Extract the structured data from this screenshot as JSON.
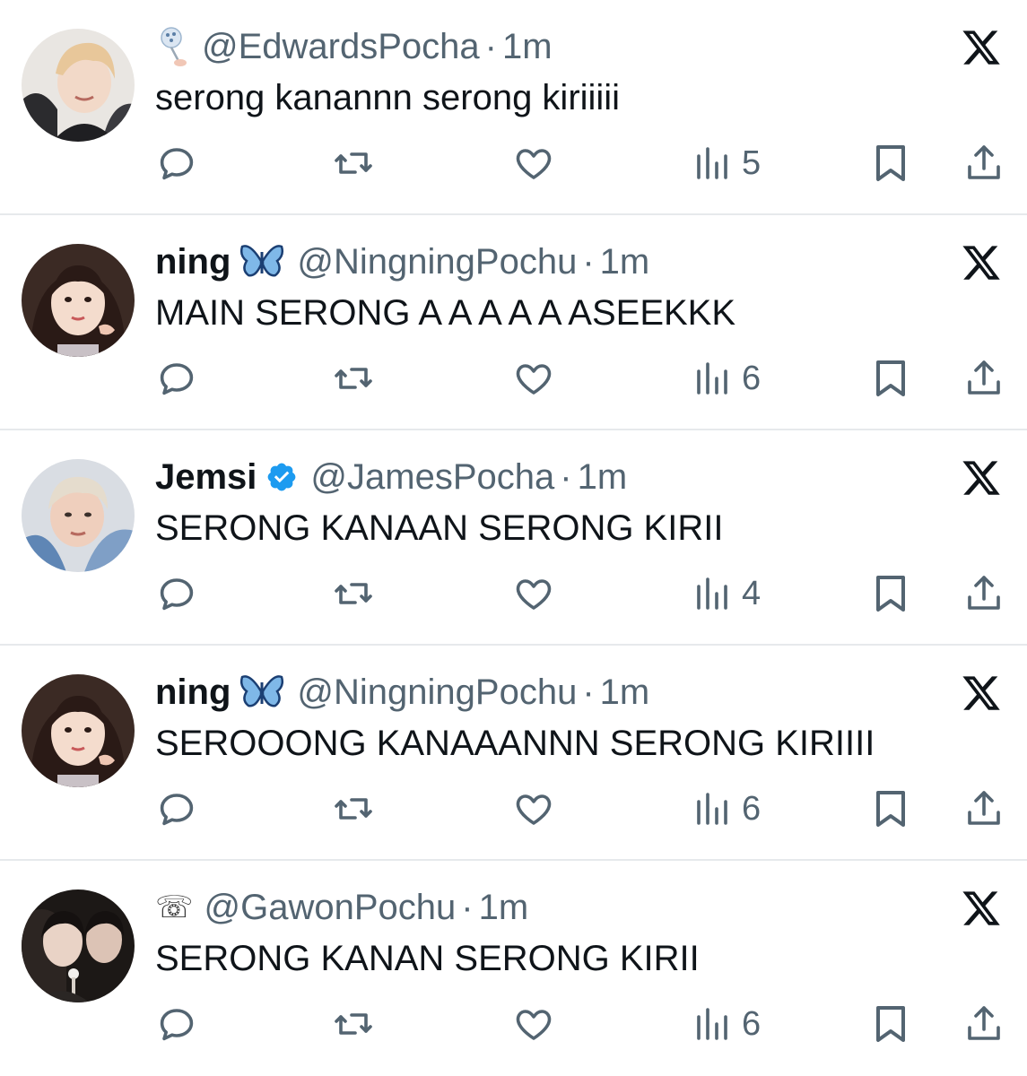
{
  "colors": {
    "text_primary": "#0f1419",
    "text_secondary": "#536471",
    "divider": "#e6e9ec",
    "verified_blue": "#1d9bf0"
  },
  "separator": "·",
  "tweets": [
    {
      "display_name": "",
      "name_emoji": "",
      "prefix_emoji": "blue-rattle-toy-icon",
      "verified": false,
      "handle": "@EdwardsPocha",
      "time": "1m",
      "text": "serong kanannn serong kiriiiii",
      "views": "5"
    },
    {
      "display_name": "ning",
      "name_emoji": "butterfly-icon",
      "prefix_emoji": "",
      "verified": false,
      "handle": "@NingningPochu",
      "time": "1m",
      "text": "MAIN SERONG A A A A A ASEEKKK",
      "views": "6"
    },
    {
      "display_name": "Jemsi",
      "name_emoji": "",
      "prefix_emoji": "",
      "verified": true,
      "handle": "@JamesPocha",
      "time": "1m",
      "text": "SERONG KANAAN SERONG KIRII",
      "views": "4"
    },
    {
      "display_name": "ning",
      "name_emoji": "butterfly-icon",
      "prefix_emoji": "",
      "verified": false,
      "handle": "@NingningPochu",
      "time": "1m",
      "text": "SEROOONG KANAAANNN SERONG KIRIIII",
      "views": "6"
    },
    {
      "display_name": "",
      "name_emoji": "",
      "prefix_emoji": "☏",
      "verified": false,
      "handle": "@GawonPochu",
      "time": "1m",
      "text": "SERONG KANAN SERONG KIRII",
      "views": "6"
    }
  ]
}
